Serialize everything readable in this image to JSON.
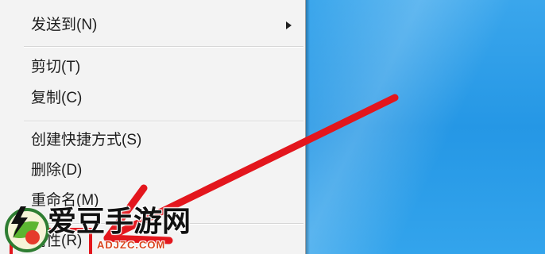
{
  "context_menu": {
    "groups": [
      [
        {
          "label": "发送到(N)",
          "has_submenu": true
        }
      ],
      [
        {
          "label": "剪切(T)"
        },
        {
          "label": "复制(C)"
        }
      ],
      [
        {
          "label": "创建快捷方式(S)"
        },
        {
          "label": "删除(D)"
        },
        {
          "label": "重命名(M)"
        }
      ],
      [
        {
          "label": "属性(R)",
          "annotated": true
        }
      ]
    ]
  },
  "watermark": {
    "site_name": "爱豆手游网",
    "domain": "ADJZC.COM"
  },
  "icons": {
    "submenu_arrow": "submenu-arrow-icon",
    "annotation_arrow": "red-arrow-icon",
    "watermark_logo": "watermark-logo-icon"
  },
  "colors": {
    "menu_background": "#f3f3f3",
    "desktop_blue": "#2a9ae6",
    "annotation_red": "#e3161d",
    "watermark_domain": "#d9461f"
  }
}
